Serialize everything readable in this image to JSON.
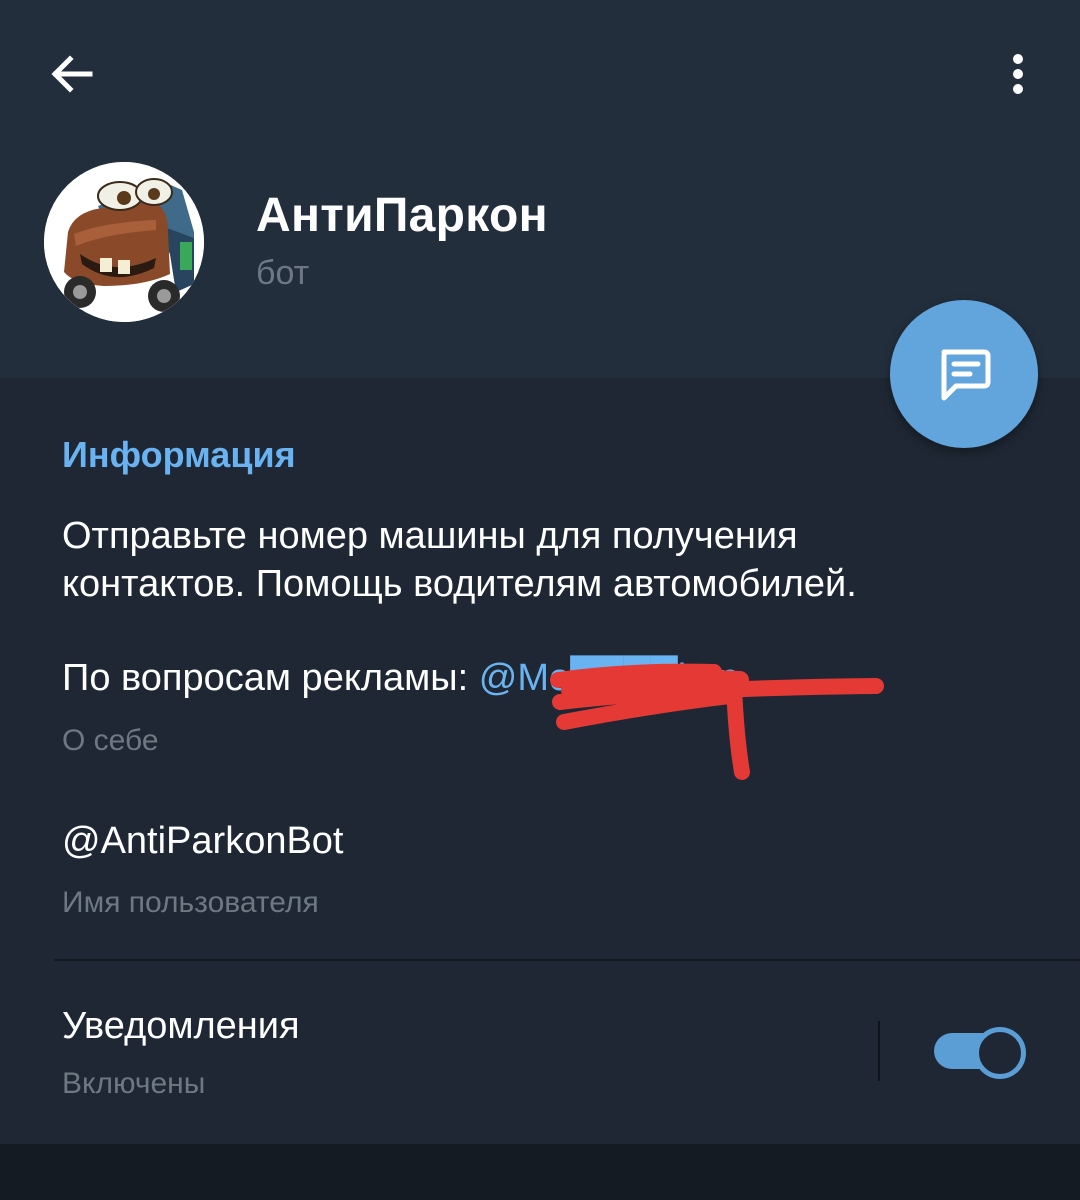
{
  "header": {
    "back_icon": "arrow-left-icon",
    "menu_icon": "more-vertical-icon",
    "name": "АнтиПаркон",
    "status": "бот",
    "avatar_icon": "cartoon-tow-truck-avatar",
    "fab_icon": "message-icon"
  },
  "info": {
    "section_title": "Информация",
    "about_line1": "Отправьте номер машины для получения",
    "about_line2": "контактов. Помощь водителям автомобилей.",
    "ads_prefix": "По вопросам рекламы: ",
    "ads_link": "@Mo████kup",
    "about_caption": "О себе",
    "username": "@AntiParkonBot",
    "username_caption": "Имя пользователя"
  },
  "notifications": {
    "title": "Уведомления",
    "status": "Включены",
    "enabled": true
  },
  "colors": {
    "header_bg": "#232e3c",
    "section_bg": "#1e2733",
    "accent": "#6ab3f3",
    "fab": "#62a5dd",
    "muted_text": "#6d7883",
    "redaction": "#e53935"
  }
}
